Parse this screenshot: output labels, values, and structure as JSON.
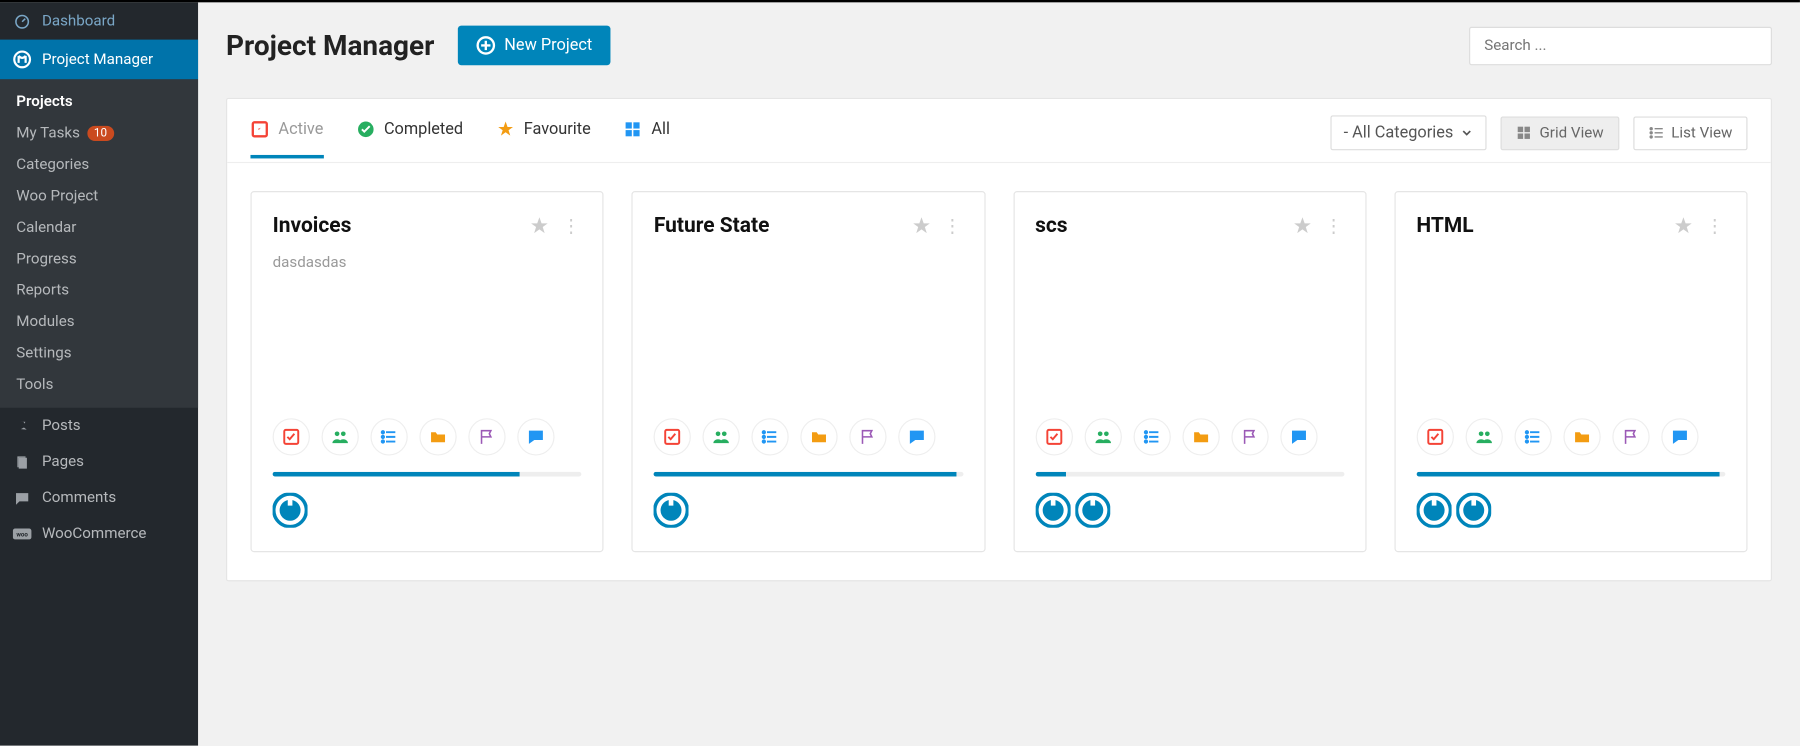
{
  "sidebar": {
    "dashboard": "Dashboard",
    "project_manager": "Project Manager",
    "submenu": [
      {
        "label": "Projects",
        "active": true
      },
      {
        "label": "My Tasks",
        "badge": "10"
      },
      {
        "label": "Categories"
      },
      {
        "label": "Woo Project"
      },
      {
        "label": "Calendar"
      },
      {
        "label": "Progress"
      },
      {
        "label": "Reports"
      },
      {
        "label": "Modules"
      },
      {
        "label": "Settings"
      },
      {
        "label": "Tools"
      }
    ],
    "posts": "Posts",
    "pages": "Pages",
    "comments": "Comments",
    "woocommerce": "WooCommerce"
  },
  "header": {
    "title": "Project Manager",
    "new_project": "New Project",
    "search_placeholder": "Search ..."
  },
  "filters": {
    "active": "Active",
    "completed": "Completed",
    "favourite": "Favourite",
    "all": "All",
    "categories": "- All Categories",
    "grid_view": "Grid View",
    "list_view": "List View"
  },
  "projects": [
    {
      "title": "Invoices",
      "desc": "dasdasdas",
      "progress": 80,
      "avatars": 1
    },
    {
      "title": "Future State",
      "desc": "",
      "progress": 98,
      "avatars": 1
    },
    {
      "title": "scs",
      "desc": "",
      "progress": 10,
      "avatars": 2
    },
    {
      "title": "HTML",
      "desc": "",
      "progress": 98,
      "avatars": 2
    }
  ],
  "colors": {
    "red": "#f44336",
    "green": "#27ae60",
    "orange": "#f39c12",
    "blue": "#2196f3",
    "purple": "#9b59b6",
    "teal": "#009688",
    "brand": "#0085ba"
  }
}
